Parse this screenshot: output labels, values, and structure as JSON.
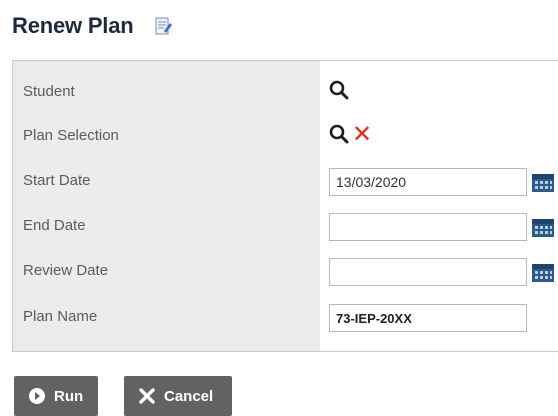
{
  "page": {
    "title": "Renew Plan"
  },
  "form": {
    "rows": [
      {
        "label": "Student"
      },
      {
        "label": "Plan Selection"
      },
      {
        "label": "Start Date",
        "value": "13/03/2020"
      },
      {
        "label": "End Date",
        "value": ""
      },
      {
        "label": "Review Date",
        "value": ""
      },
      {
        "label": "Plan Name",
        "value": "73-IEP-20XX"
      }
    ]
  },
  "buttons": {
    "run_label": "Run",
    "cancel_label": "Cancel"
  },
  "icons": {
    "title": "edit-icon",
    "student": "search-icon",
    "plan_selection": [
      "search-icon",
      "clear-x-icon"
    ],
    "dates": "calendar-icon",
    "run": "play-circle-icon",
    "cancel": "x-icon"
  },
  "colors": {
    "button_bg": "#626262",
    "clear_x": "#e8271f",
    "label_panel": "#ececec"
  }
}
